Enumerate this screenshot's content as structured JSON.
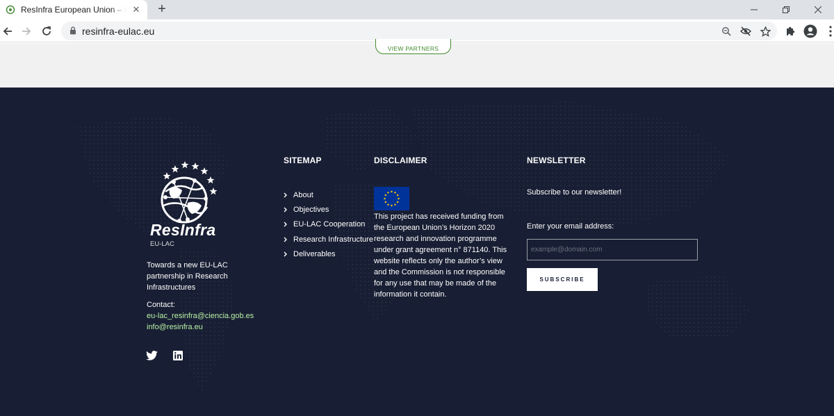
{
  "browser": {
    "tab_title": "ResInfra European Union – Latin America",
    "url": "resinfra-eulac.eu"
  },
  "page": {
    "view_partners_label": "VIEW PARTNERS"
  },
  "footer": {
    "logo_name": "ResInfra",
    "logo_sub": "EU-LAC",
    "tagline": "Towards a new EU-LAC partnership in Research Infrastructures",
    "contact_label": "Contact:",
    "emails": [
      "eu-lac_resinfra@ciencia.gob.es",
      "info@resinfra.eu"
    ],
    "sitemap": {
      "heading": "SITEMAP",
      "items": [
        "About",
        "Objectives",
        "EU-LAC Cooperation",
        "Research Infrastructure",
        "Deliverables"
      ]
    },
    "disclaimer": {
      "heading": "DISCLAIMER",
      "text": "This project has received funding from the European Union’s Horizon 2020 research and innovation programme under grant agreement n° 871140. This website reflects only the author’s view and the Commission is not responsible for any use that may be made of the information it contain."
    },
    "newsletter": {
      "heading": "NEWSLETTER",
      "subscribe_text": "Subscribe to our newsletter!",
      "email_label": "Enter your email address:",
      "email_placeholder": "example@domain.com",
      "subscribe_button": "SUBSCRIBE"
    }
  },
  "colors": {
    "footer_bg": "#181e33",
    "accent_green": "#3f8a2d",
    "email_link": "#b9f2a6",
    "eu_blue": "#003399",
    "eu_gold": "#ffcc00"
  }
}
